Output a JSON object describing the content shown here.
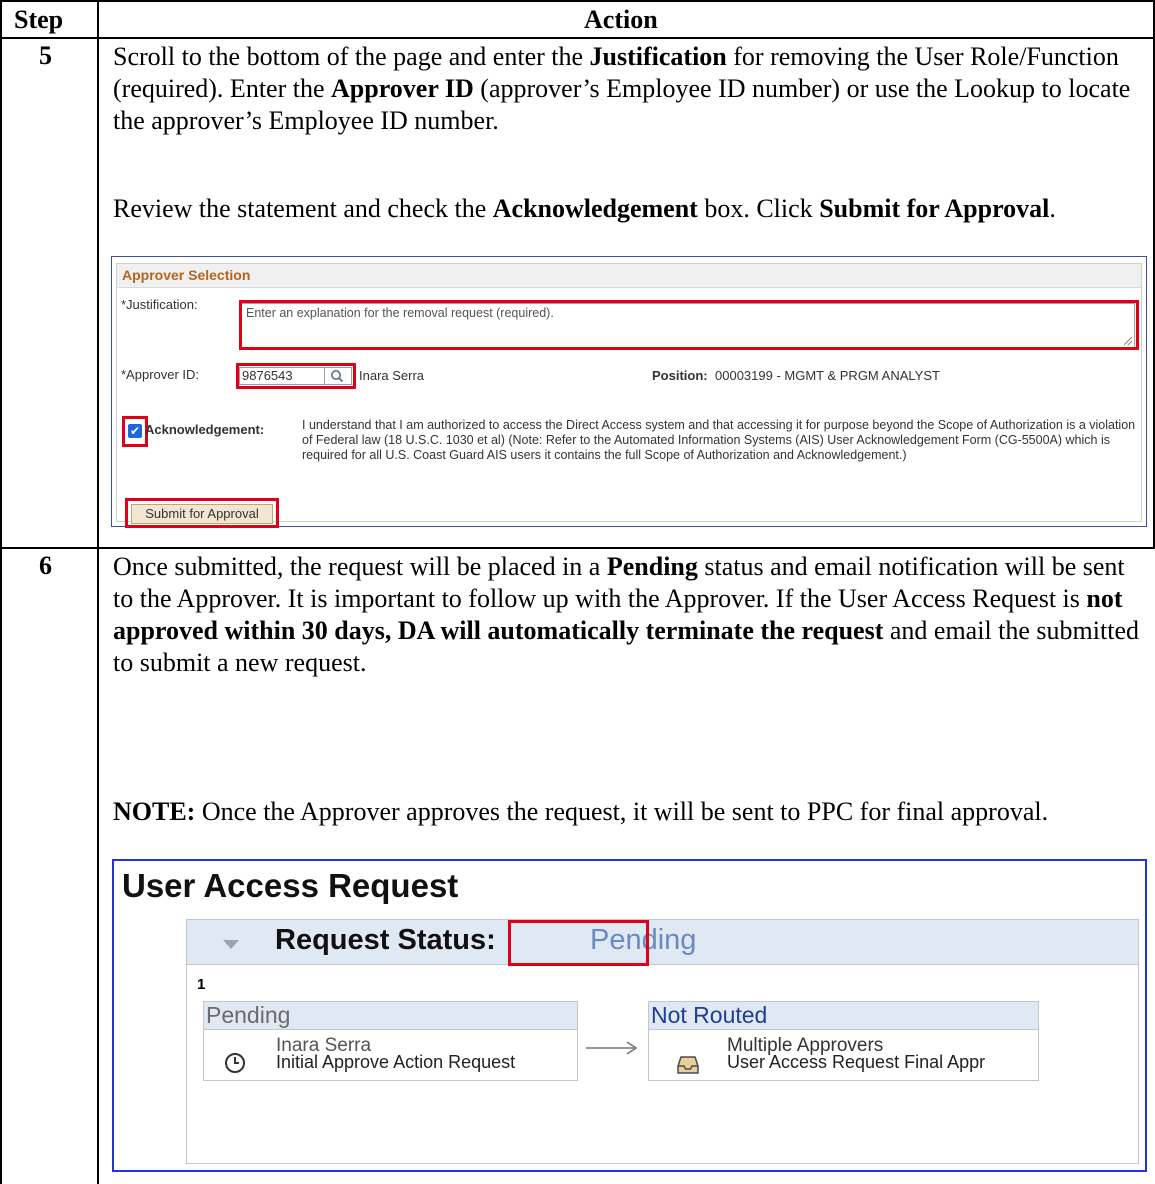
{
  "header": {
    "step_label": "Step",
    "action_label": "Action"
  },
  "step5": {
    "number": "5",
    "para1": [
      {
        "t": "Scroll to the bottom of the page and enter the ",
        "b": false
      },
      {
        "t": "Justification",
        "b": true
      },
      {
        "t": " for removing the User Role/Function (required).  Enter the ",
        "b": false
      },
      {
        "t": "Approver ID",
        "b": true
      },
      {
        "t": " (approver’s Employee ID number) or use the Lookup to locate the approver’s Employee ID number.",
        "b": false
      }
    ],
    "para2": [
      {
        "t": "Review the statement and check the ",
        "b": false
      },
      {
        "t": "Acknowledgement",
        "b": true
      },
      {
        "t": " box.  Click ",
        "b": false
      },
      {
        "t": "Submit for Approval",
        "b": true
      },
      {
        "t": ".",
        "b": false
      }
    ],
    "screenshot": {
      "panel_title": "Approver Selection",
      "justification_label": "*Justification:",
      "justification_placeholder": "Enter an explanation for the removal request (required).",
      "approver_label": "*Approver ID:",
      "approver_value": "9876543",
      "approver_name": "Inara Serra",
      "position_label": "Position:",
      "position_value": "00003199 - MGMT & PRGM ANALYST",
      "ack_label": "Acknowledgement:",
      "ack_text": "I understand that I am authorized to access the Direct Access system and that accessing it for purpose beyond the Scope of Authorization is a violation of Federal law (18 U.S.C. 1030 et al) (Note: Refer to the Automated Information Systems (AIS) User Acknowledgement Form (CG-5500A) which is required for all U.S. Coast Guard AIS users it contains the full Scope of Authorization and Acknowledgement.)",
      "ack_checked": true,
      "submit_label": "Submit for Approval",
      "highlight_color": "#e0001a"
    }
  },
  "step6": {
    "number": "6",
    "para1": [
      {
        "t": "Once submitted, the request will be placed in a ",
        "b": false
      },
      {
        "t": "Pending",
        "b": true
      },
      {
        "t": " status and email notification will be sent to the Approver.  It is important to follow up with the Approver.  If the User Access Request is ",
        "b": false
      },
      {
        "t": "not approved within 30 days, DA will automatically terminate the request",
        "b": true
      },
      {
        "t": " and email the submitted to submit a new request.",
        "b": false
      }
    ],
    "para2": [
      {
        "t": "NOTE:",
        "b": true
      },
      {
        "t": "  Once the Approver approves the request, it will be sent to PPC for final approval.",
        "b": false
      }
    ],
    "screenshot": {
      "title": "User Access Request",
      "status_label": "Request Status:",
      "status_value": "Pending",
      "path_number": "1",
      "card1": {
        "header": "Pending",
        "name": "Inara Serra",
        "action": "Initial Approve Action Request",
        "icon": "clock-icon"
      },
      "card2": {
        "header": "Not Routed",
        "name": "Multiple Approvers",
        "action": "User Access Request Final Appr",
        "icon": "inbox-tray-icon"
      },
      "header_color_pending": "#6b6b6b",
      "header_color_notrouted": "#1f3f8f"
    }
  }
}
